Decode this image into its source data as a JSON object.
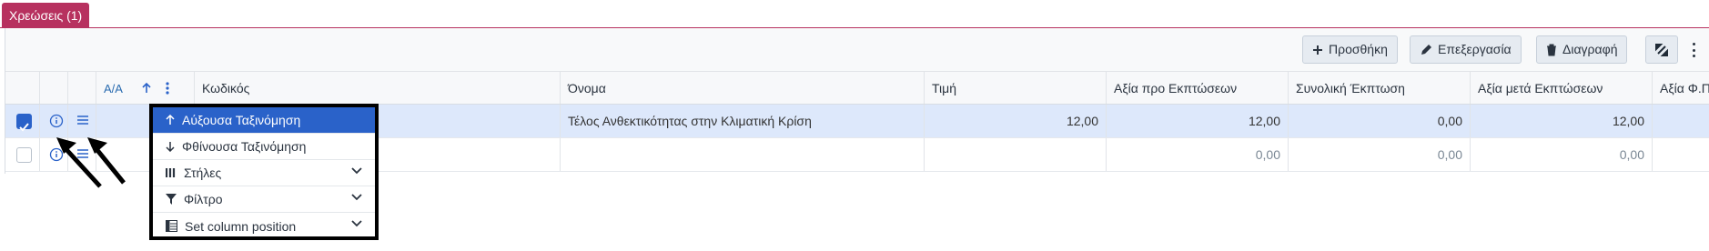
{
  "tab": {
    "label": "Χρεώσεις (1)"
  },
  "toolbar": {
    "add_label": "Προσθήκη",
    "edit_label": "Επεξεργασία",
    "delete_label": "Διαγραφή"
  },
  "columns": {
    "aa": "Α/Α",
    "code": "Κωδικός",
    "name": "Όνομα",
    "price": "Τιμή",
    "value_before": "Αξία προ Εκπτώσεων",
    "total_discount": "Συνολική Έκπτωση",
    "value_after": "Αξία μετά Εκπτώσεων",
    "value_fp": "Αξία Φ.Π"
  },
  "rows": [
    {
      "code": "",
      "name": "Τέλος Ανθεκτικότητας στην Κλιματική Κρίση",
      "price": "12,00",
      "value_before": "12,00",
      "total_discount": "0,00",
      "value_after": "12,00",
      "selected": true
    },
    {
      "code": "",
      "name": "",
      "price": "",
      "value_before": "0,00",
      "total_discount": "0,00",
      "value_after": "0,00",
      "selected": false
    }
  ],
  "column_menu": {
    "sort_asc": "Αύξουσα Ταξινόμηση",
    "sort_desc": "Φθίνουσα Ταξινόμηση",
    "columns": "Στήλες",
    "filter": "Φίλτρο",
    "set_position": "Set column position"
  },
  "colors": {
    "accent": "#b7315f",
    "primary": "#2a62c9",
    "selected_row": "#dde8fb"
  }
}
